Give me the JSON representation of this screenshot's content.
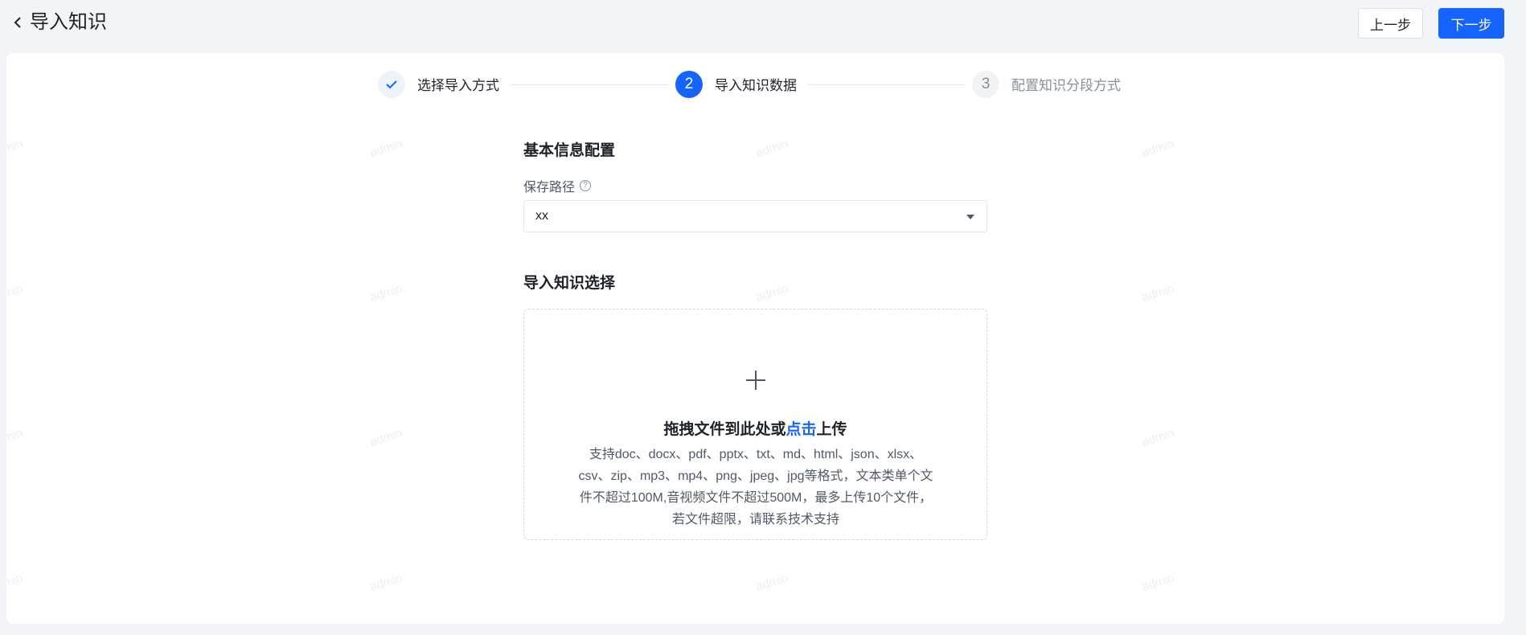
{
  "header": {
    "title": "导入知识",
    "prev_button": "上一步",
    "next_button": "下一步"
  },
  "watermark": "admin",
  "steps": [
    {
      "number": "1",
      "label": "选择导入方式",
      "status": "done"
    },
    {
      "number": "2",
      "label": "导入知识数据",
      "status": "active"
    },
    {
      "number": "3",
      "label": "配置知识分段方式",
      "status": "todo"
    }
  ],
  "basic_info": {
    "section_title": "基本信息配置",
    "save_path_label": "保存路径",
    "save_path_value": "xx"
  },
  "import_select": {
    "section_title": "导入知识选择",
    "upload_prefix": "拖拽文件到此处或",
    "upload_link": "点击",
    "upload_suffix": "上传",
    "desc_lines": [
      "支持doc、docx、pdf、pptx、txt、md、html、json、xlsx、",
      "csv、zip、mp3、mp4、png、jpeg、jpg等格式，文本类单个文",
      "件不超过100M,音视频文件不超过500M，最多上传10个文件，",
      "若文件超限，请联系技术支持"
    ]
  },
  "colors": {
    "primary": "#1664ff",
    "background": "#f2f4f8",
    "card": "#ffffff"
  }
}
